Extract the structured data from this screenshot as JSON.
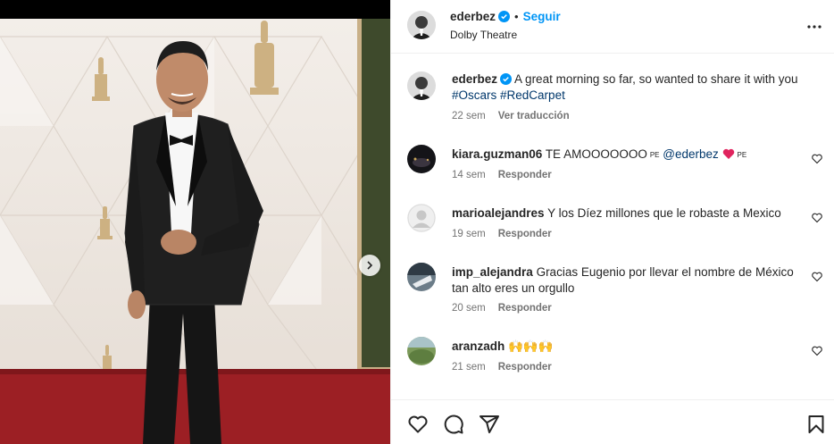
{
  "post": {
    "username": "ederbez",
    "follow_label": "Seguir",
    "location": "Dolby Theatre"
  },
  "caption": {
    "username": "ederbez",
    "text": "A great morning so far, so wanted to share it with you",
    "hashtag1": "#Oscars",
    "hashtag2": "#RedCarpet",
    "time": "22 sem",
    "translate_label": "Ver traducción"
  },
  "comments": [
    {
      "username": "kiara.guzman06",
      "text": "TE AMOOOOOOO",
      "flag_suffix": "PE",
      "mention": "@ederbez",
      "flag_suffix2": "PE",
      "time": "14 sem",
      "reply_label": "Responder"
    },
    {
      "username": "marioalejandres",
      "text": "Y los Díez millones que le robaste a Mexico",
      "time": "19 sem",
      "reply_label": "Responder"
    },
    {
      "username": "imp_alejandra",
      "text": "Gracias Eugenio por llevar el nombre de México tan alto eres un orgullo",
      "time": "20 sem",
      "reply_label": "Responder"
    },
    {
      "username": "aranzadh",
      "text": "🙌🙌🙌",
      "time": "21 sem",
      "reply_label": "Responder"
    }
  ],
  "icons": {
    "verified": "verified-badge-icon",
    "more": "more-options-icon",
    "like": "heart-icon",
    "comment": "comment-icon",
    "share": "share-icon",
    "save": "bookmark-icon",
    "next": "chevron-right-icon"
  },
  "colors": {
    "link_blue": "#0095f6",
    "hashtag": "#00376b",
    "muted": "#737373",
    "carpet_red": "#9c1f24"
  }
}
